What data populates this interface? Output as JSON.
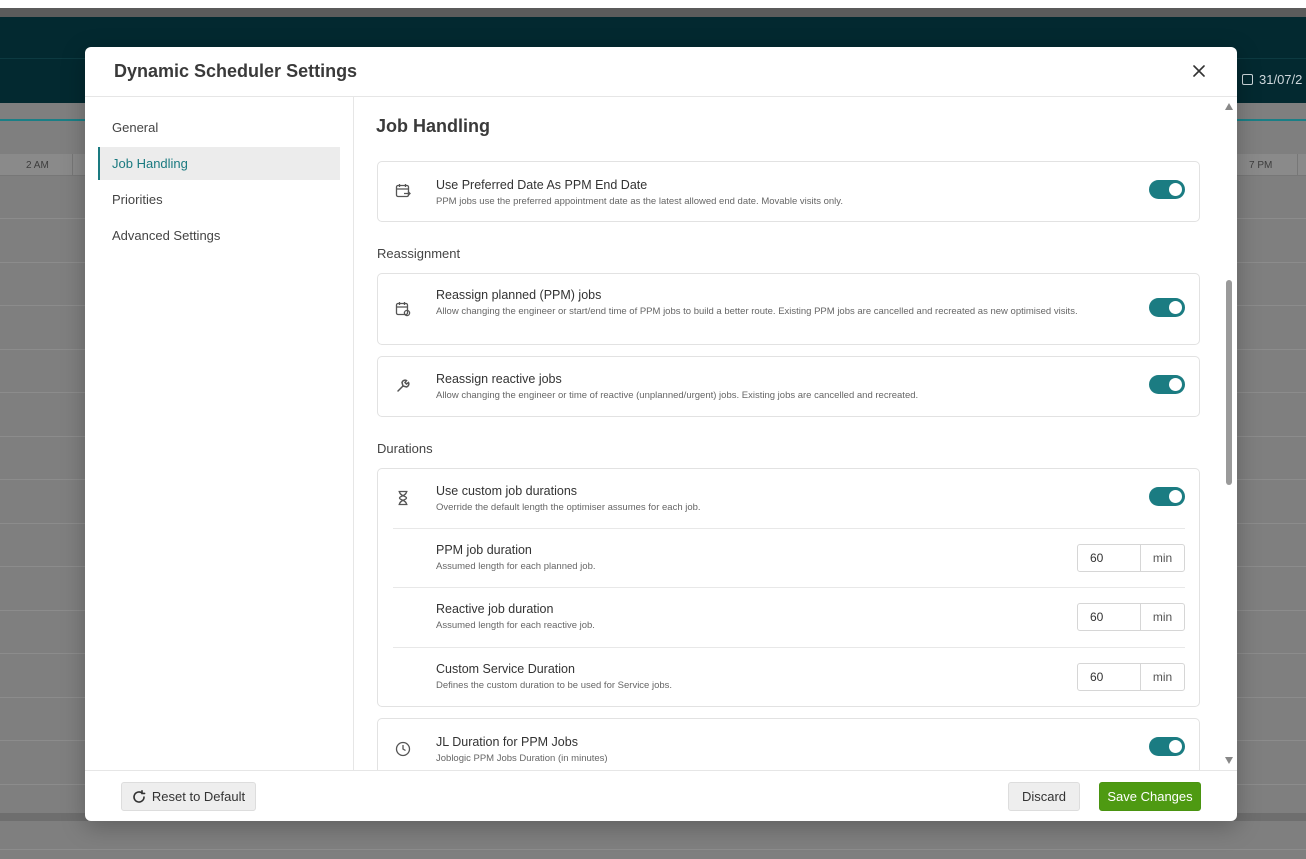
{
  "background": {
    "date_text": "31/07/2",
    "timeline": {
      "left_label": "2 AM",
      "right_label": "7 PM"
    }
  },
  "modal": {
    "title": "Dynamic Scheduler Settings",
    "close_icon": "close-icon"
  },
  "sidebar": {
    "items": [
      {
        "label": "General",
        "active": false
      },
      {
        "label": "Job Handling",
        "active": true
      },
      {
        "label": "Priorities",
        "active": false
      },
      {
        "label": "Advanced Settings",
        "active": false
      }
    ]
  },
  "content": {
    "title": "Job Handling",
    "preferred_date": {
      "icon": "calendar-arrow-icon",
      "title": "Use Preferred Date As PPM End Date",
      "desc": "PPM jobs use the preferred appointment date as the latest allowed end date. Movable visits only.",
      "enabled": true
    },
    "reassignment": {
      "label": "Reassignment",
      "ppm": {
        "icon": "calendar-refresh-icon",
        "title": "Reassign planned (PPM) jobs",
        "desc": "Allow changing the engineer or start/end time of PPM jobs to build a better route. Existing PPM jobs are cancelled and recreated as new optimised visits.",
        "enabled": true
      },
      "reactive": {
        "icon": "wrench-icon",
        "title": "Reassign reactive jobs",
        "desc": "Allow changing the engineer or time of reactive (unplanned/urgent) jobs. Existing jobs are cancelled and recreated.",
        "enabled": true
      }
    },
    "durations": {
      "label": "Durations",
      "custom": {
        "icon": "hourglass-icon",
        "title": "Use custom job durations",
        "desc": "Override the default length the optimiser assumes for each job.",
        "enabled": true
      },
      "ppm_duration": {
        "title": "PPM job duration",
        "desc": "Assumed length for each planned job.",
        "value": "60",
        "unit": "min"
      },
      "reactive_duration": {
        "title": "Reactive job duration",
        "desc": "Assumed length for each reactive job.",
        "value": "60",
        "unit": "min"
      },
      "service_duration": {
        "title": "Custom Service Duration",
        "desc": "Defines the custom duration to be used for Service jobs.",
        "value": "60",
        "unit": "min"
      }
    },
    "jl_duration": {
      "icon": "clock-icon",
      "title": "JL Duration for PPM Jobs",
      "desc": "Joblogic PPM Jobs Duration (in minutes)",
      "enabled": true
    }
  },
  "footer": {
    "reset_label": "Reset to Default",
    "discard_label": "Discard",
    "save_label": "Save Changes"
  },
  "colors": {
    "accent": "#1b7c82",
    "save": "#4e9a12",
    "header_dark": "#032930"
  }
}
